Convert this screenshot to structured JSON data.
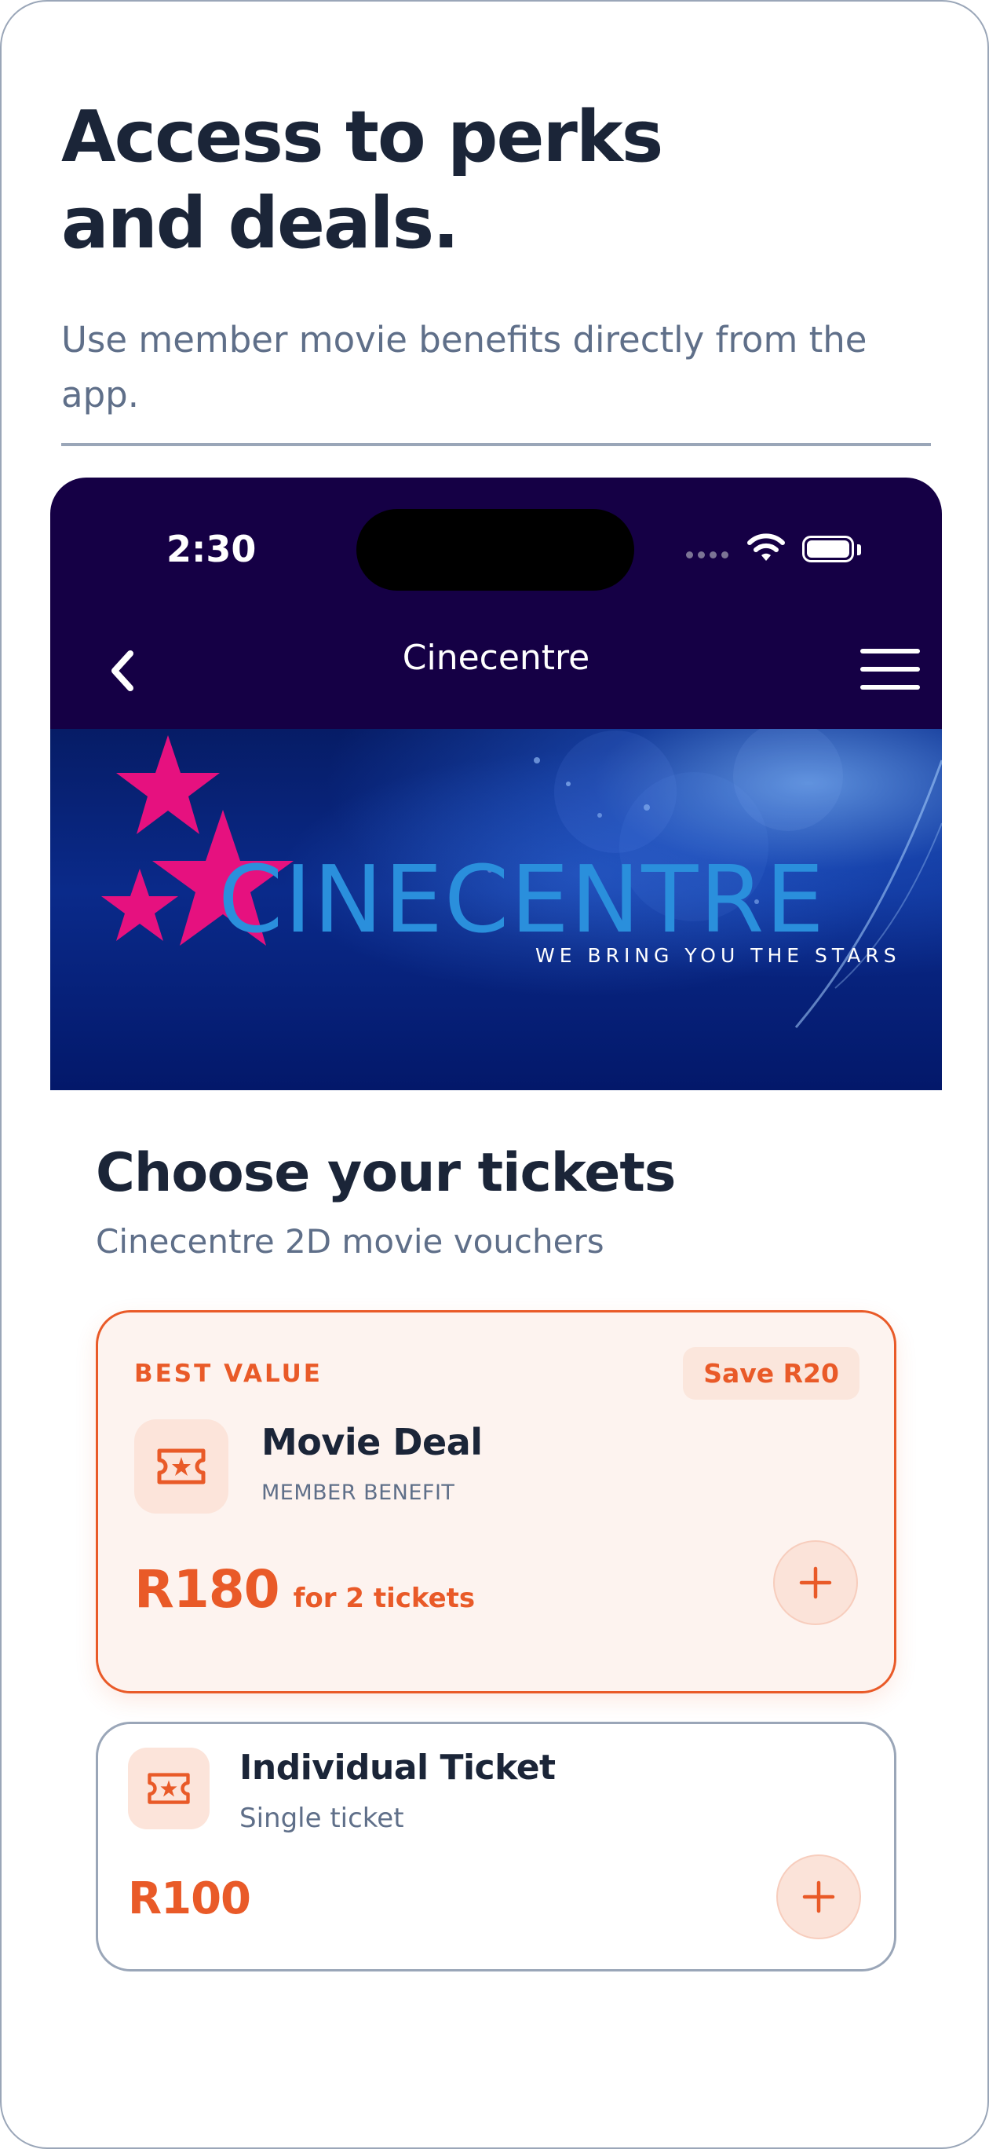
{
  "promo": {
    "headline_line1": "Access to perks",
    "headline_line2": "and deals.",
    "subtext": "Use member movie benefits directly from the app."
  },
  "status_bar": {
    "time": "2:30"
  },
  "nav": {
    "title": "Cinecentre",
    "back_icon": "chevron-left-icon",
    "menu_icon": "hamburger-menu-icon"
  },
  "banner": {
    "logo_text": "CINECENTRE",
    "tagline": "WE BRING YOU THE STARS"
  },
  "tickets": {
    "title": "Choose your tickets",
    "subtitle": "Cinecentre 2D movie vouchers",
    "options": [
      {
        "badge": "BEST VALUE",
        "savings": "Save R20",
        "name": "Movie Deal",
        "meta": "MEMBER BENEFIT",
        "price": "R180",
        "price_note": "for 2 tickets",
        "icon": "ticket-icon"
      },
      {
        "name": "Individual Ticket",
        "meta": "Single ticket",
        "price": "R100",
        "icon": "ticket-icon"
      }
    ]
  },
  "colors": {
    "accent": "#e95a28",
    "nav_bg": "#150045",
    "text": "#1b2538",
    "muted": "#5f6f89",
    "logo_star": "#e6117f",
    "logo_text": "#2a8fdc"
  }
}
